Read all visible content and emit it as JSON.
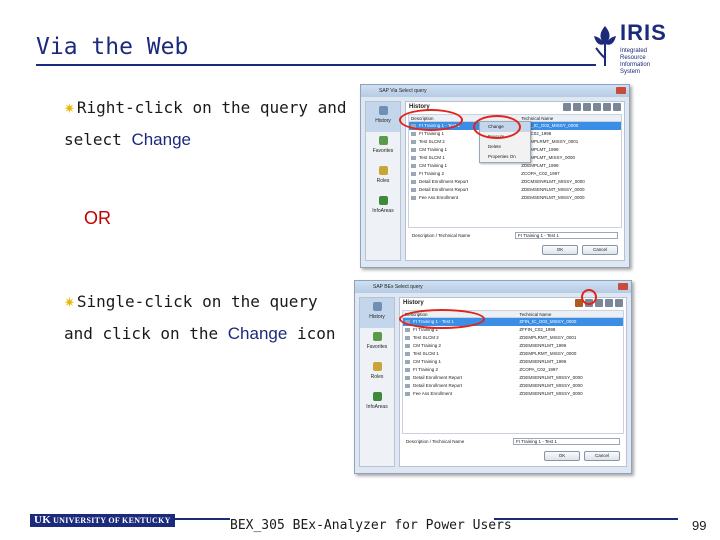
{
  "slide": {
    "title": "Via the Web",
    "logo": {
      "word": "IRIS",
      "sub": "Integrated Resource Information System"
    },
    "bullet1": {
      "pre": "Right-click on the query and select ",
      "keyword": "Change"
    },
    "or": "OR",
    "bullet2": {
      "pre": "Single-click on the query and click on the ",
      "keyword": "Change",
      "post": " icon"
    },
    "footer": {
      "org": "UNIVERSITY OF KENTUCKY",
      "course": "BEX_305 BEx-Analyzer for Power Users",
      "page": "99"
    }
  },
  "dialog1": {
    "window_title": "SAP Via Select query",
    "sidebar": [
      "History",
      "Favorites",
      "Roles",
      "InfoAreas"
    ],
    "panel_title": "History",
    "columns": [
      "Description",
      "Technical Name"
    ],
    "rows": [
      {
        "desc": "FI Training 1 - Test 1",
        "tech": "ZFIN_IC_O02_MISSY_0000"
      },
      {
        "desc": "FI Training 1",
        "tech": "ZFI_C02_1998"
      },
      {
        "desc": "Test SLCM 2",
        "tech": "ZDEMPLRMT_MISSY_0001"
      },
      {
        "desc": "CM Training 1",
        "tech": "ZDEMPLMT_1999"
      },
      {
        "desc": "Test SLCM 1",
        "tech": "ZDEMPLMT_MISSY_0000"
      },
      {
        "desc": "CM Training 1",
        "tech": "ZDEMPLMT_1999"
      },
      {
        "desc": "FI Training 2",
        "tech": "ZCOPA_C02_1997"
      },
      {
        "desc": "Detail Enrollment Report",
        "tech": "ZDCMSENRLMT_MISSY_0000"
      },
      {
        "desc": "Detail Enrollment Report",
        "tech": "ZDEMSENRLMT_MISSY_0000"
      },
      {
        "desc": "Fee Ass Enrollment",
        "tech": "ZDEMSENRLMT_MISSY_0000"
      }
    ],
    "context_menu": [
      "Change",
      "Execute",
      "Delete",
      "Properties On"
    ],
    "desc_label": "Description / Technical Name",
    "desc_value": "FI Training 1 - Test 1",
    "ok": "OK",
    "cancel": "Cancel"
  },
  "dialog2": {
    "window_title": "SAP BEx Select query",
    "sidebar": [
      "History",
      "Favorites",
      "Roles",
      "InfoAreas"
    ],
    "panel_title": "History",
    "columns": [
      "Description",
      "Technical Name"
    ],
    "rows": [
      {
        "desc": "FI Training 1 - Test 1",
        "tech": "ZFIN_IC_O02_MISSY_0000"
      },
      {
        "desc": "FI Training 1",
        "tech": "ZFFIN_C02_1998"
      },
      {
        "desc": "Test SLCM 2",
        "tech": "ZDEMPLRMT_MISSY_0001"
      },
      {
        "desc": "CM Training 2",
        "tech": "ZDEMSENRLMT_1999"
      },
      {
        "desc": "Test SLCM 1",
        "tech": "ZDEMPLRMT_MISSY_0000"
      },
      {
        "desc": "CM Training 1",
        "tech": "ZDEMSENRLMT_1999"
      },
      {
        "desc": "FI Training 2",
        "tech": "ZCOPA_C02_1997"
      },
      {
        "desc": "Detail Enrollment Report",
        "tech": "ZDEMSENRLMT_MISSY_0000"
      },
      {
        "desc": "Detail Enrollment Report",
        "tech": "ZDEMSENRLMT_MISSY_0000"
      },
      {
        "desc": "Fee Ass Enrollment",
        "tech": "ZDEMSENRLMT_MISSY_0000"
      }
    ],
    "desc_label": "Description / Technical Name",
    "desc_value": "FI Training 1 - Test 1",
    "ok": "OK",
    "cancel": "Cancel"
  },
  "colors": {
    "title": "#1b2a7a",
    "accent": "#e8b90a",
    "or": "#c00000",
    "highlight": "#e0231b"
  }
}
